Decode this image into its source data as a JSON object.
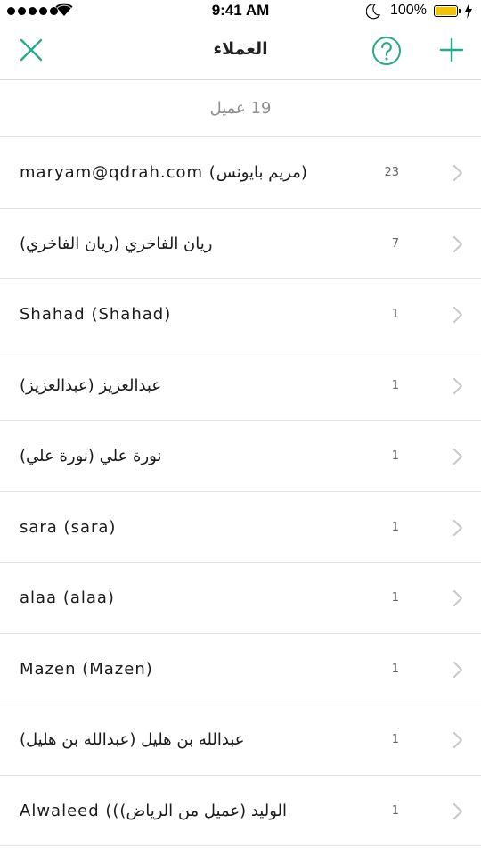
{
  "status_bar": {
    "time": "9:41 AM",
    "battery": "100%",
    "icons": [
      "signal-dots",
      "wifi-icon",
      "moon-icon",
      "battery-icon",
      "charging-bolt-icon"
    ]
  },
  "nav": {
    "title": "العملاء",
    "icons": [
      "close-icon",
      "help-icon",
      "add-icon"
    ],
    "accent_color": "#27A98A"
  },
  "summary": {
    "count_label": "19 عميل"
  },
  "customers": [
    {
      "name": "maryam@qdrah.com (مريم بايونس)",
      "count": "23"
    },
    {
      "name": "ريان الفاخري (ريان الفاخري)",
      "count": "7"
    },
    {
      "name": "Shahad (Shahad)",
      "count": "1"
    },
    {
      "name": "عبدالعزيز (عبدالعزيز)",
      "count": "1"
    },
    {
      "name": "نورة علي (نورة علي)",
      "count": "1"
    },
    {
      "name": "sara (sara)",
      "count": "1"
    },
    {
      "name": "alaa (alaa)",
      "count": "1"
    },
    {
      "name": "Mazen (Mazen)",
      "count": "1"
    },
    {
      "name": "عبدالله بن هليل (عبدالله بن هليل)",
      "count": "1"
    },
    {
      "name": "Alwaleed ((الوليد (عميل من الرياض)",
      "count": "1"
    }
  ]
}
